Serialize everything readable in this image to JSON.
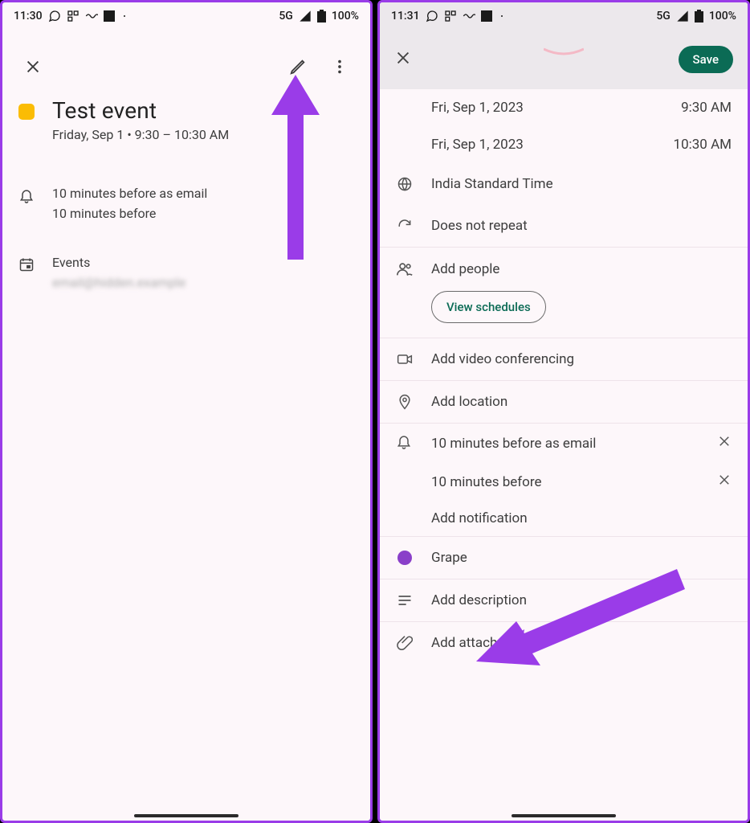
{
  "left": {
    "status": {
      "time": "11:30",
      "network": "5G",
      "battery": "100%"
    },
    "event": {
      "title": "Test event",
      "subtitle": "Friday, Sep 1  •  9:30 – 10:30 AM"
    },
    "reminders": [
      "10 minutes before as email",
      "10 minutes before"
    ],
    "calendar": {
      "label": "Events",
      "account": "email@hidden.example"
    }
  },
  "right": {
    "status": {
      "time": "11:31",
      "network": "5G",
      "battery": "100%"
    },
    "header": {
      "save": "Save"
    },
    "times": {
      "start_date": "Fri, Sep 1, 2023",
      "start_time": "9:30 AM",
      "end_date": "Fri, Sep 1, 2023",
      "end_time": "10:30 AM"
    },
    "timezone": "India Standard Time",
    "recurrence": "Does not repeat",
    "people": {
      "label": "Add people",
      "view_schedules": "View schedules"
    },
    "video": "Add video conferencing",
    "location": "Add location",
    "notifications": {
      "items": [
        "10 minutes before as email",
        "10 minutes before"
      ],
      "add": "Add notification"
    },
    "color": {
      "name": "Grape",
      "hex": "#8a3fc9"
    },
    "description": "Add description",
    "attachment": "Add attachment"
  }
}
